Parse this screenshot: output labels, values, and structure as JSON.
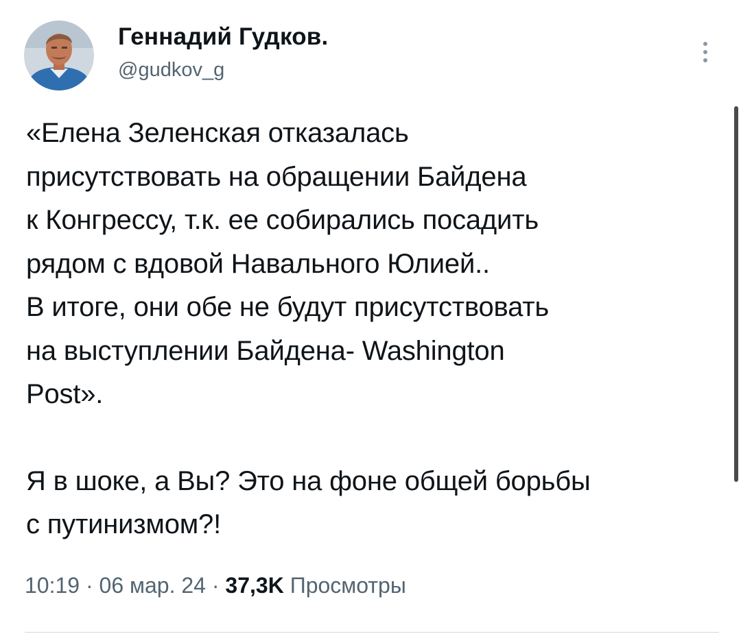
{
  "author": {
    "name": "Геннадий Гудков.",
    "handle": "@gudkov_g",
    "avatar_icon": "profile-photo"
  },
  "menu": {
    "icon": "vertical-ellipsis-icon"
  },
  "tweet": {
    "paragraph_1": "«Елена Зеленская отказалась\nприсутствовать на обращении Байдена\nк Конгрессу, т.к. ее собирались посадить\nрядом с вдовой Навального Юлией..\nВ итоге, они обе не будут присутствовать\nна выступлении Байдена- Washington\nPost».",
    "paragraph_2": "Я в шоке, а Вы? Это на фоне общей борьбы\nс путинизмом?!"
  },
  "meta": {
    "time": "10:19",
    "separator": " · ",
    "date": "06 мар. 24",
    "views_count": "37,3K",
    "views_label": "Просмотры"
  },
  "colors": {
    "text": "#0f1419",
    "secondary_text": "#536471",
    "divider": "#cfd9de"
  }
}
